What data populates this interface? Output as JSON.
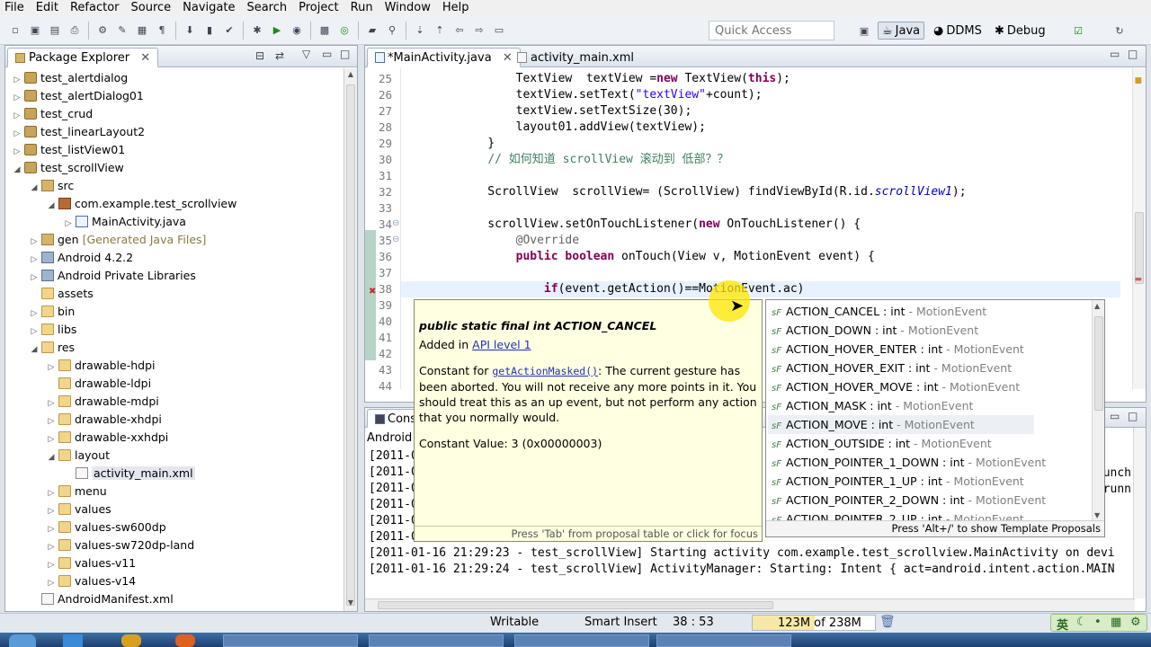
{
  "menu": [
    "File",
    "Edit",
    "Refactor",
    "Source",
    "Navigate",
    "Search",
    "Project",
    "Run",
    "Window",
    "Help"
  ],
  "toolbar": {
    "quick_access_placeholder": "Quick Access",
    "perspectives": [
      "Java",
      "DDMS",
      "Debug"
    ]
  },
  "package_explorer": {
    "title": "Package Explorer",
    "tree": [
      {
        "label": "test_alertdialog",
        "depth": 0,
        "tw": "▷",
        "icon": "proj"
      },
      {
        "label": "test_alertDialog01",
        "depth": 0,
        "tw": "▷",
        "icon": "proj"
      },
      {
        "label": "test_crud",
        "depth": 0,
        "tw": "▷",
        "icon": "proj"
      },
      {
        "label": "test_linearLayout2",
        "depth": 0,
        "tw": "▷",
        "icon": "proj"
      },
      {
        "label": "test_listView01",
        "depth": 0,
        "tw": "▷",
        "icon": "proj"
      },
      {
        "label": "test_scrollView",
        "depth": 0,
        "tw": "◢",
        "icon": "proj"
      },
      {
        "label": "src",
        "depth": 1,
        "tw": "◢",
        "icon": "src"
      },
      {
        "label": "com.example.test_scrollview",
        "depth": 2,
        "tw": "◢",
        "icon": "pkg"
      },
      {
        "label": "MainActivity.java",
        "depth": 3,
        "tw": "▷",
        "icon": "java"
      },
      {
        "label": "gen",
        "suffix": "[Generated Java Files]",
        "depth": 1,
        "tw": "▷",
        "icon": "src"
      },
      {
        "label": "Android 4.2.2",
        "depth": 1,
        "tw": "▷",
        "icon": "lib"
      },
      {
        "label": "Android Private Libraries",
        "depth": 1,
        "tw": "▷",
        "icon": "lib"
      },
      {
        "label": "assets",
        "depth": 1,
        "tw": "",
        "icon": "folder"
      },
      {
        "label": "bin",
        "depth": 1,
        "tw": "▷",
        "icon": "folder"
      },
      {
        "label": "libs",
        "depth": 1,
        "tw": "▷",
        "icon": "folder"
      },
      {
        "label": "res",
        "depth": 1,
        "tw": "◢",
        "icon": "folder"
      },
      {
        "label": "drawable-hdpi",
        "depth": 2,
        "tw": "▷",
        "icon": "folder"
      },
      {
        "label": "drawable-ldpi",
        "depth": 2,
        "tw": "",
        "icon": "folder"
      },
      {
        "label": "drawable-mdpi",
        "depth": 2,
        "tw": "▷",
        "icon": "folder"
      },
      {
        "label": "drawable-xhdpi",
        "depth": 2,
        "tw": "▷",
        "icon": "folder"
      },
      {
        "label": "drawable-xxhdpi",
        "depth": 2,
        "tw": "▷",
        "icon": "folder"
      },
      {
        "label": "layout",
        "depth": 2,
        "tw": "◢",
        "icon": "folder"
      },
      {
        "label": "activity_main.xml",
        "depth": 3,
        "tw": "",
        "icon": "xml"
      },
      {
        "label": "menu",
        "depth": 2,
        "tw": "▷",
        "icon": "folder"
      },
      {
        "label": "values",
        "depth": 2,
        "tw": "▷",
        "icon": "folder"
      },
      {
        "label": "values-sw600dp",
        "depth": 2,
        "tw": "▷",
        "icon": "folder"
      },
      {
        "label": "values-sw720dp-land",
        "depth": 2,
        "tw": "▷",
        "icon": "folder"
      },
      {
        "label": "values-v11",
        "depth": 2,
        "tw": "▷",
        "icon": "folder"
      },
      {
        "label": "values-v14",
        "depth": 2,
        "tw": "▷",
        "icon": "folder"
      },
      {
        "label": "AndroidManifest.xml",
        "depth": 1,
        "tw": "",
        "icon": "xml"
      }
    ]
  },
  "editor": {
    "tabs": [
      "*MainActivity.java",
      "activity_main.xml"
    ],
    "lines": [
      {
        "n": "25",
        "html": "        TextView  textView =<span class=\"kw\">new</span> TextView(<span class=\"kw\">this</span>);"
      },
      {
        "n": "26",
        "html": "        textView.setText(<span class=\"str\">\"textView\"</span>+count);"
      },
      {
        "n": "27",
        "html": "        textView.setTextSize(30);"
      },
      {
        "n": "28",
        "html": "        layout01.addView(textView);"
      },
      {
        "n": "29",
        "html": "    }"
      },
      {
        "n": "30",
        "html": "    <span class=\"cmt\">// 如何知道 scrollView 滚动到 低部？？</span>"
      },
      {
        "n": "31",
        "html": ""
      },
      {
        "n": "32",
        "html": "    ScrollView  scrollView= (ScrollView) findViewById(R.id.<span class=\"ital\">scrollView1</span>);"
      },
      {
        "n": "33",
        "html": ""
      },
      {
        "n": "34",
        "html": "    scrollView.setOnTouchListener(<span class=\"kw\">new</span> OnTouchListener() {"
      },
      {
        "n": "35",
        "html": "        <span class=\"ann\">@Override</span>"
      },
      {
        "n": "36",
        "html": "        <span class=\"kw\">public boolean</span> onTouch(View v, MotionEvent event) {"
      },
      {
        "n": "37",
        "html": ""
      },
      {
        "n": "38",
        "html": "            <span class=\"kw\">if</span>(event.getAction()==MotionEvent.ac)"
      },
      {
        "n": "39",
        "html": ""
      },
      {
        "n": "40",
        "html": ""
      },
      {
        "n": "41",
        "html": ""
      },
      {
        "n": "42",
        "html": ""
      },
      {
        "n": "43",
        "html": ""
      },
      {
        "n": "44",
        "html": ""
      }
    ]
  },
  "console": {
    "tab": "Conso",
    "subtitle": "Android",
    "lines": [
      "[2011-0",
      "[2011-0",
      "[2011-0",
      "[2011-0",
      "[2011-0",
      "[2011-0",
      "[2011-01-16 21:29:23 - test_scrollView] Starting activity com.example.test_scrollview.MainActivity on devi",
      "[2011-01-16 21:29:24 - test_scrollView] ActivityManager: Starting: Intent { act=android.intent.action.MAIN"
    ],
    "right_fragments": [
      "unch",
      "runn"
    ]
  },
  "doc_popup": {
    "title": "public static final int ACTION_CANCEL",
    "added_prefix": "Added in ",
    "added_link": "API level 1",
    "desc_prefix": "Constant for ",
    "desc_link": "getActionMasked()",
    "desc_rest": ": The current gesture has been aborted. You will not receive any more points in it. You should treat this as an up event, but not perform any action that you normally would.",
    "constant": "Constant Value: 3 (0x00000003)",
    "footer": "Press 'Tab' from proposal table or click for focus"
  },
  "proposals": {
    "items": [
      {
        "name": "ACTION_CANCEL : int",
        "type": " - MotionEvent"
      },
      {
        "name": "ACTION_DOWN : int",
        "type": " - MotionEvent"
      },
      {
        "name": "ACTION_HOVER_ENTER : int",
        "type": " - MotionEvent"
      },
      {
        "name": "ACTION_HOVER_EXIT : int",
        "type": " - MotionEvent"
      },
      {
        "name": "ACTION_HOVER_MOVE : int",
        "type": " - MotionEvent"
      },
      {
        "name": "ACTION_MASK : int",
        "type": " - MotionEvent"
      },
      {
        "name": "ACTION_MOVE : int",
        "type": " - MotionEvent"
      },
      {
        "name": "ACTION_OUTSIDE : int",
        "type": " - MotionEvent"
      },
      {
        "name": "ACTION_POINTER_1_DOWN : int",
        "type": " - MotionEvent"
      },
      {
        "name": "ACTION_POINTER_1_UP : int",
        "type": " - MotionEvent"
      },
      {
        "name": "ACTION_POINTER_2_DOWN : int",
        "type": " - MotionEvent"
      },
      {
        "name": "ACTION_POINTER_2_UP : int",
        "type": " - MotionEvent"
      }
    ],
    "footer": "Press 'Alt+/' to show Template Proposals"
  },
  "status": {
    "writable": "Writable",
    "insert_mode": "Smart Insert",
    "position": "38 : 53",
    "memory": "123M of 238M",
    "ime": "英"
  }
}
